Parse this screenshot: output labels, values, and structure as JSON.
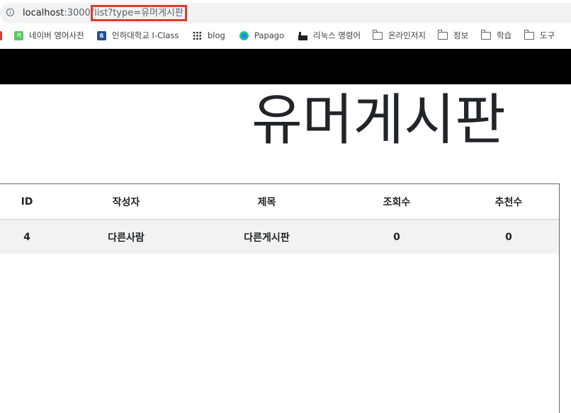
{
  "browser": {
    "url_host": "localhost",
    "url_port": ":3000",
    "url_sep": "/",
    "url_path": "list?type=유머게시판"
  },
  "bookmarks": [
    {
      "label": "네이버 영어사전",
      "icon": "naver-dictionary-icon"
    },
    {
      "label": "인하대학교 I-Class",
      "icon": "inha-logo-icon"
    },
    {
      "label": "blog",
      "icon": "blog-dots-icon"
    },
    {
      "label": "Papago",
      "icon": "papago-icon"
    },
    {
      "label": "리눅스 명령어",
      "icon": "factory-icon"
    },
    {
      "label": "온라인저지",
      "icon": "folder-icon"
    },
    {
      "label": "정보",
      "icon": "folder-icon"
    },
    {
      "label": "학습",
      "icon": "folder-icon"
    },
    {
      "label": "도구",
      "icon": "folder-icon"
    }
  ],
  "page": {
    "title": "유머게시판"
  },
  "table": {
    "headers": [
      "ID",
      "작성자",
      "제목",
      "조회수",
      "추천수"
    ],
    "rows": [
      [
        "4",
        "다른사람",
        "다른게시판",
        "0",
        "0"
      ]
    ]
  },
  "colors": {
    "navbar": "#000000",
    "highlight_outline": "#e03a2f",
    "row_background": "#f2f2f2"
  }
}
